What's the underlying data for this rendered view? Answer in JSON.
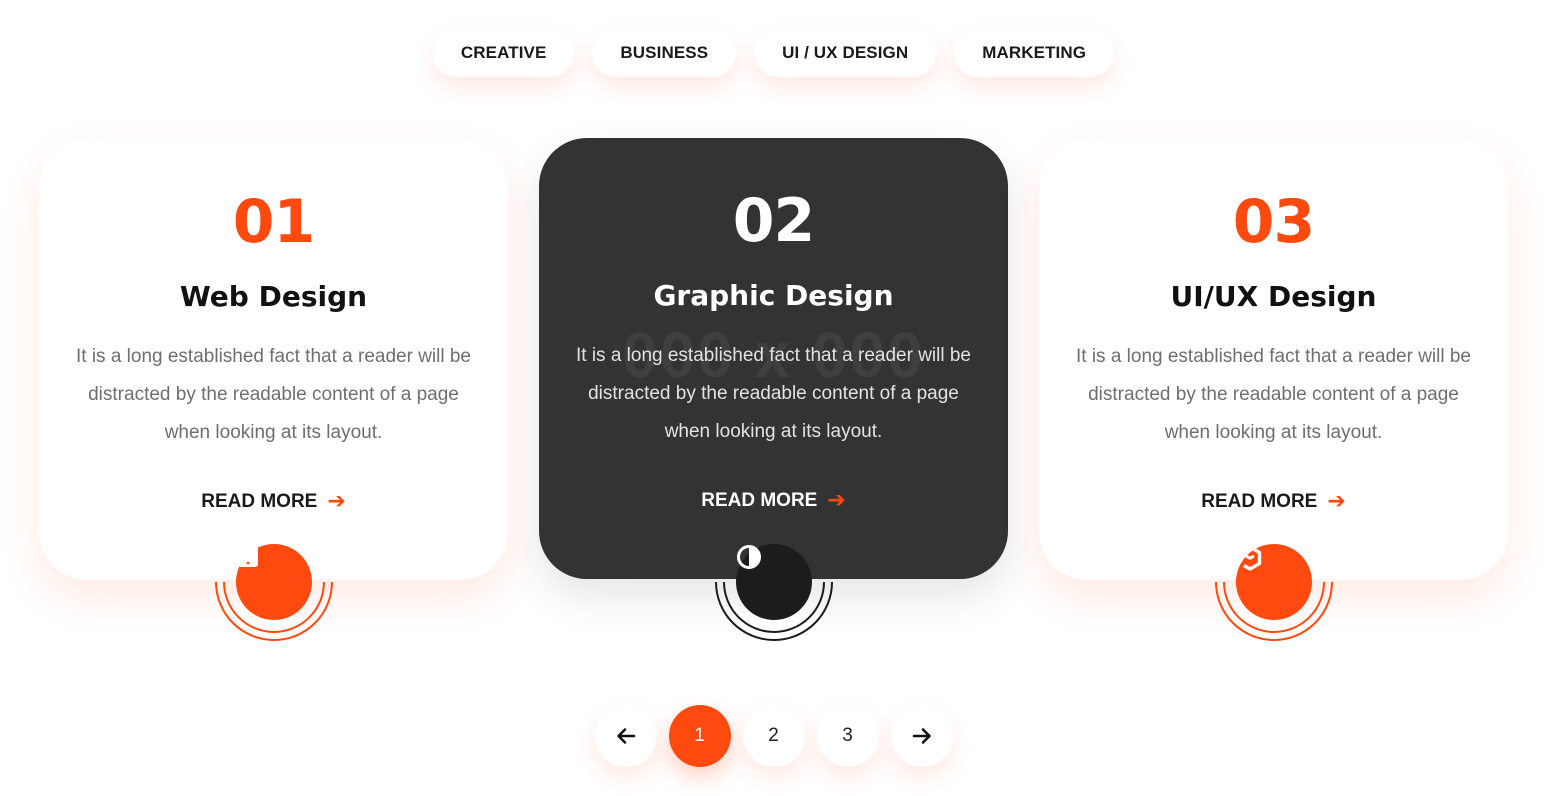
{
  "tabs": [
    {
      "label": "CREATIVE"
    },
    {
      "label": "BUSINESS"
    },
    {
      "label": "UI / UX DESIGN"
    },
    {
      "label": "MARKETING"
    }
  ],
  "cards": [
    {
      "number": "01",
      "title": "Web Design",
      "description": "It is a long established fact that a reader will be distracted by the readable content of a page when looking at its layout.",
      "read_more": "READ MORE",
      "icon": "tablet-icon"
    },
    {
      "number": "02",
      "title": "Graphic Design",
      "watermark": "000 x 000",
      "description": "It is a long established fact that a reader will be distracted by the readable content of a page when looking at its layout.",
      "read_more": "READ MORE",
      "icon": "contrast-icon"
    },
    {
      "number": "03",
      "title": "UI/UX Design",
      "description": "It is a long established fact that a reader will be distracted by the readable content of a page when looking at its layout.",
      "read_more": "READ MORE",
      "icon": "cube-icon"
    }
  ],
  "pagination": {
    "pages": [
      "1",
      "2",
      "3"
    ],
    "active_page": 1,
    "prev_icon": "arrow-left-icon",
    "next_icon": "arrow-right-icon"
  },
  "colors": {
    "accent": "#ff4a0f",
    "dark_card": "#333333",
    "text": "#1a1a1a",
    "muted": "#6f6f6f"
  }
}
